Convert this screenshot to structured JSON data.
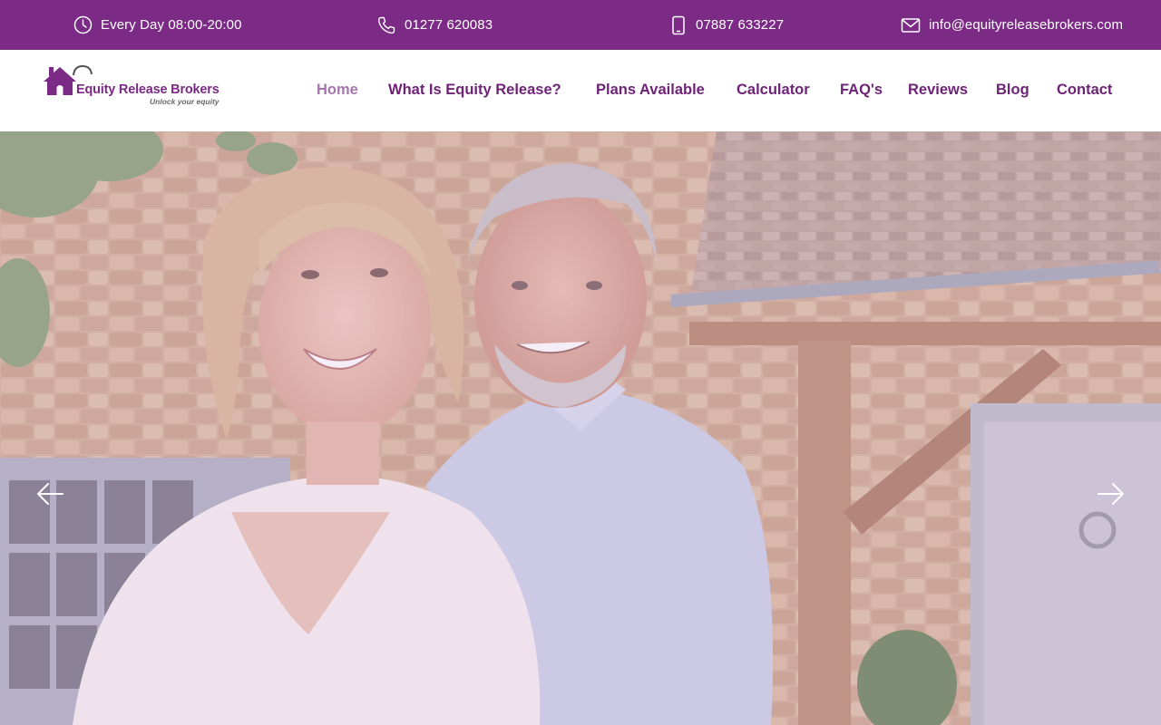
{
  "topbar": {
    "hours": "Every Day 08:00-20:00",
    "phone": "01277 620083",
    "mobile": "07887 633227",
    "email": "info@equityreleasebrokers.com",
    "icons": [
      "clock-icon",
      "phone-icon",
      "mobile-icon",
      "envelope-icon"
    ]
  },
  "logo": {
    "name": "Equity Release Brokers",
    "tagline": "Unlock your equity"
  },
  "nav": {
    "items": [
      {
        "label": "Home",
        "active": true
      },
      {
        "label": "What Is Equity Release?"
      },
      {
        "label": "Plans Available"
      },
      {
        "label": "Calculator"
      },
      {
        "label": "FAQ's"
      },
      {
        "label": "Reviews"
      },
      {
        "label": "Blog"
      },
      {
        "label": "Contact"
      }
    ]
  },
  "hero": {
    "image": "smiling-senior-couple-outside-stone-cottage",
    "controls": [
      "arrow-left-icon",
      "arrow-right-icon"
    ]
  },
  "colors": {
    "brand_purple": "#7b2a85",
    "nav_text": "#6f2378",
    "nav_active": "#a674ae",
    "topbar_text": "#ffffff"
  }
}
